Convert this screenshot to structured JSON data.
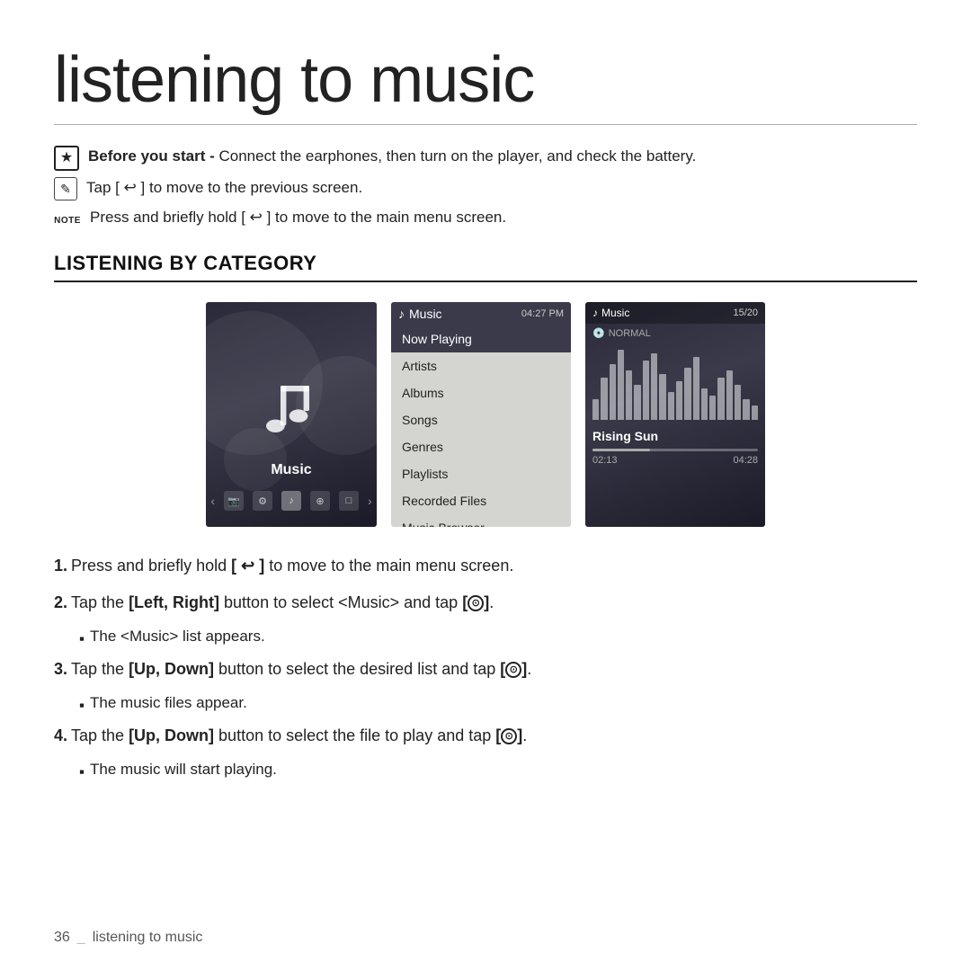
{
  "page": {
    "title": "listening to music",
    "footer_page_num": "36",
    "footer_label": "listening to music"
  },
  "tips": {
    "tip1_bold": "Before you start -",
    "tip1_text": " Connect the earphones, then turn on the player, and check the battery.",
    "tip2_text": "Tap [ ↩ ] to move to the previous screen.",
    "tip3_text": "Press and briefly hold [ ↩ ] to move to the main menu screen."
  },
  "section_heading": "LISTENING BY CATEGORY",
  "screens": {
    "screen1": {
      "label": "Music",
      "nav_items": [
        "◀",
        "📷",
        "⚙",
        "♪",
        "⊕",
        "□",
        "▶"
      ]
    },
    "screen2": {
      "header_title": "Music",
      "header_time": "04:27 PM",
      "menu_items": [
        {
          "label": "Now Playing",
          "active": true
        },
        {
          "label": "Artists",
          "active": false
        },
        {
          "label": "Albums",
          "active": false
        },
        {
          "label": "Songs",
          "active": false
        },
        {
          "label": "Genres",
          "active": false
        },
        {
          "label": "Playlists",
          "active": false
        },
        {
          "label": "Recorded Files",
          "active": false
        },
        {
          "label": "Music Browser",
          "active": false
        }
      ]
    },
    "screen3": {
      "header_title": "Music",
      "header_track": "15/20",
      "mode": "NORMAL",
      "song_title": "Rising Sun",
      "time_current": "02:13",
      "time_total": "04:28",
      "progress_percent": 35
    }
  },
  "instructions": [
    {
      "number": "1.",
      "text": "Press and briefly hold [ ↩ ] to move to the main menu screen."
    },
    {
      "number": "2.",
      "text_before": "Tap the ",
      "bold": "Left, Right",
      "text_after": " button to select ",
      "bold2": "Music",
      "text_end": " and tap [ ⊙ ].",
      "sub": "The <Music> list appears."
    },
    {
      "number": "3.",
      "text_before": "Tap the ",
      "bold": "Up, Down",
      "text_after": " button to select the desired list and tap [ ⊙ ].",
      "sub": "The music files appear."
    },
    {
      "number": "4.",
      "text_before": "Tap the ",
      "bold": "Up, Down",
      "text_after": " button to select the file to play and tap [ ⊙ ].",
      "sub": "The music will start playing."
    }
  ]
}
